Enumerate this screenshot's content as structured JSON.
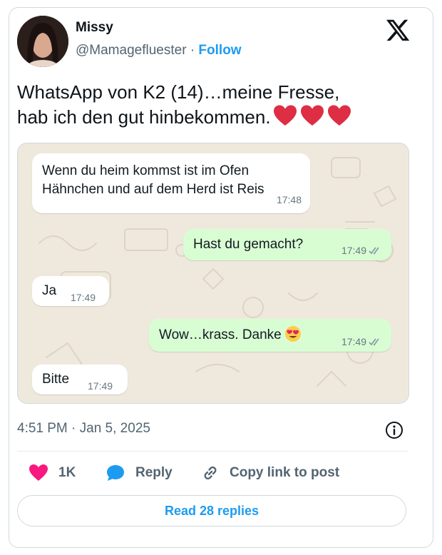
{
  "author": {
    "name": "Missy",
    "handle": "@Mamagefluester",
    "separator": "·",
    "follow_label": "Follow"
  },
  "tweet": {
    "text": "WhatsApp von K2 (14)…meine Fresse,\nhab ich den gut hinbekommen.",
    "emoji_hearts": 3,
    "timestamp": "4:51 PM · Jan 5, 2025"
  },
  "chat": {
    "messages": [
      {
        "direction": "incoming",
        "text": "Wenn du heim kommst ist im Ofen\nHähnchen und auf dem Herd ist Reis",
        "time": "17:48"
      },
      {
        "direction": "outgoing",
        "text": "Hast du gemacht?",
        "time": "17:49",
        "read_ticks": true
      },
      {
        "direction": "incoming",
        "text": "Ja",
        "time": "17:49"
      },
      {
        "direction": "outgoing",
        "text": "Wow…krass. Danke",
        "emoji": "heart-eyes-emoji",
        "time": "17:49",
        "read_ticks": true
      },
      {
        "direction": "incoming",
        "text": "Bitte",
        "time": "17:49"
      }
    ]
  },
  "actions": {
    "like_count": "1K",
    "reply_label": "Reply",
    "copy_label": "Copy link to post"
  },
  "read_replies_label": "Read 28 replies",
  "colors": {
    "accent": "#1d9bf0",
    "like_pink": "#f91880",
    "heart_red": "#dd2e44",
    "outgoing_bubble": "#d9fdd3",
    "chat_bg": "#efe9dd"
  },
  "icons": [
    "x-logo-icon",
    "info-icon",
    "like-heart-icon",
    "reply-bubble-icon",
    "link-icon",
    "double-check-icon",
    "heart-eyes-emoji"
  ]
}
